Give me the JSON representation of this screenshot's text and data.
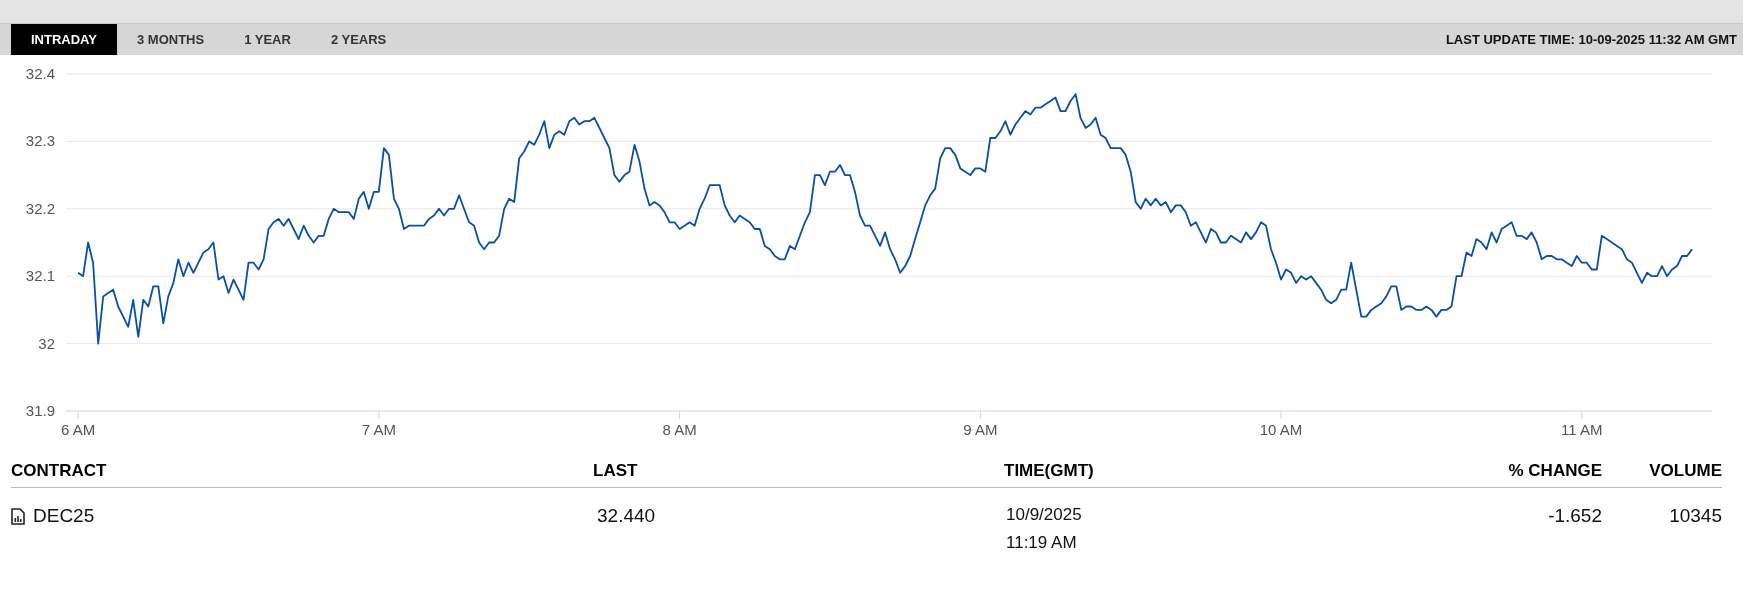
{
  "tabs": [
    {
      "label": "INTRADAY",
      "selected": true
    },
    {
      "label": "3 MONTHS",
      "selected": false
    },
    {
      "label": "1 YEAR",
      "selected": false
    },
    {
      "label": "2 YEARS",
      "selected": false
    }
  ],
  "last_update": "LAST UPDATE TIME: 10-09-2025 11:32 AM GMT",
  "chart_data": {
    "type": "line",
    "grid": true,
    "xlim": [
      5.983,
      11.433
    ],
    "ylim": [
      31.9,
      32.4
    ],
    "x": [
      6,
      6.0167,
      6.0333,
      6.05,
      6.0667,
      6.0833,
      6.1,
      6.1167,
      6.1333,
      6.15,
      6.1667,
      6.1833,
      6.2,
      6.2167,
      6.2333,
      6.25,
      6.2667,
      6.2833,
      6.3,
      6.3167,
      6.3333,
      6.35,
      6.3667,
      6.3833,
      6.4,
      6.4167,
      6.4333,
      6.45,
      6.4667,
      6.4833,
      6.5,
      6.5167,
      6.5333,
      6.55,
      6.5667,
      6.5833,
      6.6,
      6.6167,
      6.6333,
      6.65,
      6.6667,
      6.6833,
      6.7,
      6.7167,
      6.7333,
      6.75,
      6.7667,
      6.7833,
      6.8,
      6.8167,
      6.8333,
      6.85,
      6.8667,
      6.8833,
      6.9,
      6.9167,
      6.9333,
      6.95,
      6.9667,
      6.9833,
      7,
      7.0167,
      7.0333,
      7.05,
      7.0667,
      7.0833,
      7.1,
      7.1167,
      7.1333,
      7.15,
      7.1667,
      7.1833,
      7.2,
      7.2167,
      7.2333,
      7.25,
      7.2667,
      7.2833,
      7.3,
      7.3167,
      7.3333,
      7.35,
      7.3667,
      7.3833,
      7.4,
      7.4167,
      7.4333,
      7.45,
      7.4667,
      7.4833,
      7.5,
      7.5167,
      7.5333,
      7.55,
      7.5667,
      7.5833,
      7.6,
      7.6167,
      7.6333,
      7.65,
      7.6667,
      7.6833,
      7.7,
      7.7167,
      7.7333,
      7.75,
      7.7667,
      7.7833,
      7.8,
      7.8167,
      7.8333,
      7.85,
      7.8667,
      7.8833,
      7.9,
      7.9167,
      7.9333,
      7.95,
      7.9667,
      7.9833,
      8,
      8.0167,
      8.0333,
      8.05,
      8.0667,
      8.0833,
      8.1,
      8.1167,
      8.1333,
      8.15,
      8.1667,
      8.1833,
      8.2,
      8.2167,
      8.2333,
      8.25,
      8.2667,
      8.2833,
      8.3,
      8.3167,
      8.3333,
      8.35,
      8.3667,
      8.3833,
      8.4,
      8.4167,
      8.4333,
      8.45,
      8.4667,
      8.4833,
      8.5,
      8.5167,
      8.5333,
      8.55,
      8.5667,
      8.5833,
      8.6,
      8.6167,
      8.6333,
      8.65,
      8.6667,
      8.6833,
      8.7,
      8.7167,
      8.7333,
      8.75,
      8.7667,
      8.7833,
      8.8,
      8.8167,
      8.8333,
      8.85,
      8.8667,
      8.8833,
      8.9,
      8.9167,
      8.9333,
      8.95,
      8.9667,
      8.9833,
      9,
      9.0167,
      9.0333,
      9.05,
      9.0667,
      9.0833,
      9.1,
      9.1167,
      9.1333,
      9.15,
      9.1667,
      9.1833,
      9.2,
      9.2167,
      9.2333,
      9.25,
      9.2667,
      9.2833,
      9.3,
      9.3167,
      9.3333,
      9.35,
      9.3667,
      9.3833,
      9.4,
      9.4167,
      9.4333,
      9.45,
      9.4667,
      9.4833,
      9.5,
      9.5167,
      9.5333,
      9.55,
      9.5667,
      9.5833,
      9.6,
      9.6167,
      9.6333,
      9.65,
      9.6667,
      9.6833,
      9.7,
      9.7167,
      9.7333,
      9.75,
      9.7667,
      9.7833,
      9.8,
      9.8167,
      9.8333,
      9.85,
      9.8667,
      9.8833,
      9.9,
      9.9167,
      9.9333,
      9.95,
      9.9667,
      9.9833,
      10,
      10.0167,
      10.0333,
      10.05,
      10.0667,
      10.0833,
      10.1,
      10.1167,
      10.1333,
      10.15,
      10.1667,
      10.1833,
      10.2,
      10.2167,
      10.2333,
      10.25,
      10.2667,
      10.2833,
      10.3,
      10.3167,
      10.3333,
      10.35,
      10.3667,
      10.3833,
      10.4,
      10.4167,
      10.4333,
      10.45,
      10.4667,
      10.4833,
      10.5,
      10.5167,
      10.5333,
      10.55,
      10.5667,
      10.5833,
      10.6,
      10.6167,
      10.6333,
      10.65,
      10.6667,
      10.6833,
      10.7,
      10.7167,
      10.7333,
      10.75,
      10.7667,
      10.7833,
      10.8,
      10.8167,
      10.8333,
      10.85,
      10.8667,
      10.8833,
      10.9,
      10.9167,
      10.9333,
      10.95,
      10.9667,
      10.9833,
      11,
      11.0167,
      11.0333,
      11.05,
      11.0667,
      11.0833,
      11.1,
      11.1167,
      11.1333,
      11.15,
      11.1667,
      11.1833,
      11.2,
      11.2167,
      11.2333,
      11.25,
      11.2667,
      11.2833,
      11.3,
      11.3167,
      11.3333,
      11.35,
      11.3667
    ],
    "yticks": [
      31.9,
      32,
      32.1,
      32.2,
      32.3,
      32.4
    ],
    "xticks": [
      {
        "value": 6,
        "label": "6 AM"
      },
      {
        "value": 7,
        "label": "7 AM"
      },
      {
        "value": 8,
        "label": "8 AM"
      },
      {
        "value": 9,
        "label": "9 AM"
      },
      {
        "value": 10,
        "label": "10 AM"
      },
      {
        "value": 11,
        "label": "11 AM"
      }
    ],
    "series": [
      {
        "color": "#0a4fa0",
        "values": [
          32.105,
          32.1,
          32.15,
          32.12,
          32.0,
          32.07,
          32.075,
          32.08,
          32.055,
          32.04,
          32.025,
          32.065,
          32.01,
          32.065,
          32.055,
          32.085,
          32.085,
          32.03,
          32.07,
          32.09,
          32.125,
          32.1,
          32.12,
          32.105,
          32.12,
          32.135,
          32.14,
          32.15,
          32.095,
          32.1,
          32.075,
          32.095,
          32.08,
          32.065,
          32.12,
          32.12,
          32.11,
          32.125,
          32.17,
          32.18,
          32.185,
          32.175,
          32.185,
          32.17,
          32.155,
          32.175,
          32.16,
          32.15,
          32.16,
          32.16,
          32.185,
          32.2,
          32.195,
          32.195,
          32.195,
          32.185,
          32.215,
          32.225,
          32.2,
          32.225,
          32.225,
          32.29,
          32.28,
          32.215,
          32.2,
          32.17,
          32.175,
          32.175,
          32.175,
          32.175,
          32.185,
          32.19,
          32.2,
          32.19,
          32.2,
          32.2,
          32.22,
          32.2,
          32.18,
          32.175,
          32.15,
          32.14,
          32.15,
          32.15,
          32.16,
          32.2,
          32.215,
          32.21,
          32.275,
          32.285,
          32.3,
          32.295,
          32.31,
          32.33,
          32.29,
          32.31,
          32.315,
          32.31,
          32.33,
          32.335,
          32.325,
          32.33,
          32.33,
          32.335,
          32.32,
          32.305,
          32.29,
          32.25,
          32.24,
          32.25,
          32.255,
          32.295,
          32.27,
          32.23,
          32.205,
          32.21,
          32.205,
          32.195,
          32.18,
          32.18,
          32.17,
          32.175,
          32.18,
          32.175,
          32.2,
          32.215,
          32.235,
          32.235,
          32.235,
          32.205,
          32.19,
          32.18,
          32.19,
          32.185,
          32.18,
          32.17,
          32.17,
          32.145,
          32.14,
          32.13,
          32.125,
          32.125,
          32.145,
          32.14,
          32.16,
          32.18,
          32.195,
          32.25,
          32.25,
          32.235,
          32.255,
          32.255,
          32.265,
          32.25,
          32.25,
          32.225,
          32.19,
          32.175,
          32.175,
          32.16,
          32.145,
          32.165,
          32.14,
          32.125,
          32.105,
          32.115,
          32.13,
          32.155,
          32.18,
          32.205,
          32.22,
          32.23,
          32.275,
          32.29,
          32.29,
          32.28,
          32.26,
          32.255,
          32.25,
          32.26,
          32.26,
          32.255,
          32.305,
          32.305,
          32.315,
          32.33,
          32.31,
          32.325,
          32.335,
          32.345,
          32.34,
          32.35,
          32.35,
          32.355,
          32.36,
          32.365,
          32.345,
          32.345,
          32.36,
          32.37,
          32.335,
          32.32,
          32.325,
          32.335,
          32.31,
          32.305,
          32.29,
          32.29,
          32.29,
          32.28,
          32.255,
          32.21,
          32.2,
          32.215,
          32.205,
          32.215,
          32.205,
          32.21,
          32.195,
          32.205,
          32.205,
          32.195,
          32.175,
          32.18,
          32.165,
          32.15,
          32.17,
          32.165,
          32.15,
          32.15,
          32.16,
          32.155,
          32.15,
          32.165,
          32.155,
          32.165,
          32.18,
          32.175,
          32.14,
          32.12,
          32.095,
          32.11,
          32.105,
          32.09,
          32.1,
          32.095,
          32.1,
          32.09,
          32.08,
          32.065,
          32.06,
          32.065,
          32.08,
          32.08,
          32.12,
          32.08,
          32.04,
          32.04,
          32.05,
          32.055,
          32.06,
          32.07,
          32.085,
          32.085,
          32.05,
          32.055,
          32.055,
          32.05,
          32.05,
          32.055,
          32.05,
          32.04,
          32.05,
          32.05,
          32.055,
          32.1,
          32.1,
          32.135,
          32.13,
          32.155,
          32.15,
          32.14,
          32.165,
          32.15,
          32.17,
          32.175,
          32.18,
          32.16,
          32.16,
          32.155,
          32.165,
          32.15,
          32.125,
          32.13,
          32.13,
          32.125,
          32.125,
          32.12,
          32.115,
          32.13,
          32.12,
          32.12,
          32.11,
          32.11,
          32.16,
          32.155,
          32.15,
          32.145,
          32.14,
          32.125,
          32.12,
          32.105,
          32.09,
          32.105,
          32.1,
          32.1,
          32.115,
          32.1,
          32.11,
          32.115,
          32.13,
          32.13,
          32.14
        ]
      }
    ]
  },
  "table": {
    "columns": [
      "CONTRACT",
      "LAST",
      "TIME(GMT)",
      "% CHANGE",
      "VOLUME"
    ],
    "rows": [
      {
        "contract": "DEC25",
        "last": "32.440",
        "date": "10/9/2025",
        "time": "11:19 AM",
        "change": "-1.652",
        "volume": "10345"
      }
    ]
  }
}
